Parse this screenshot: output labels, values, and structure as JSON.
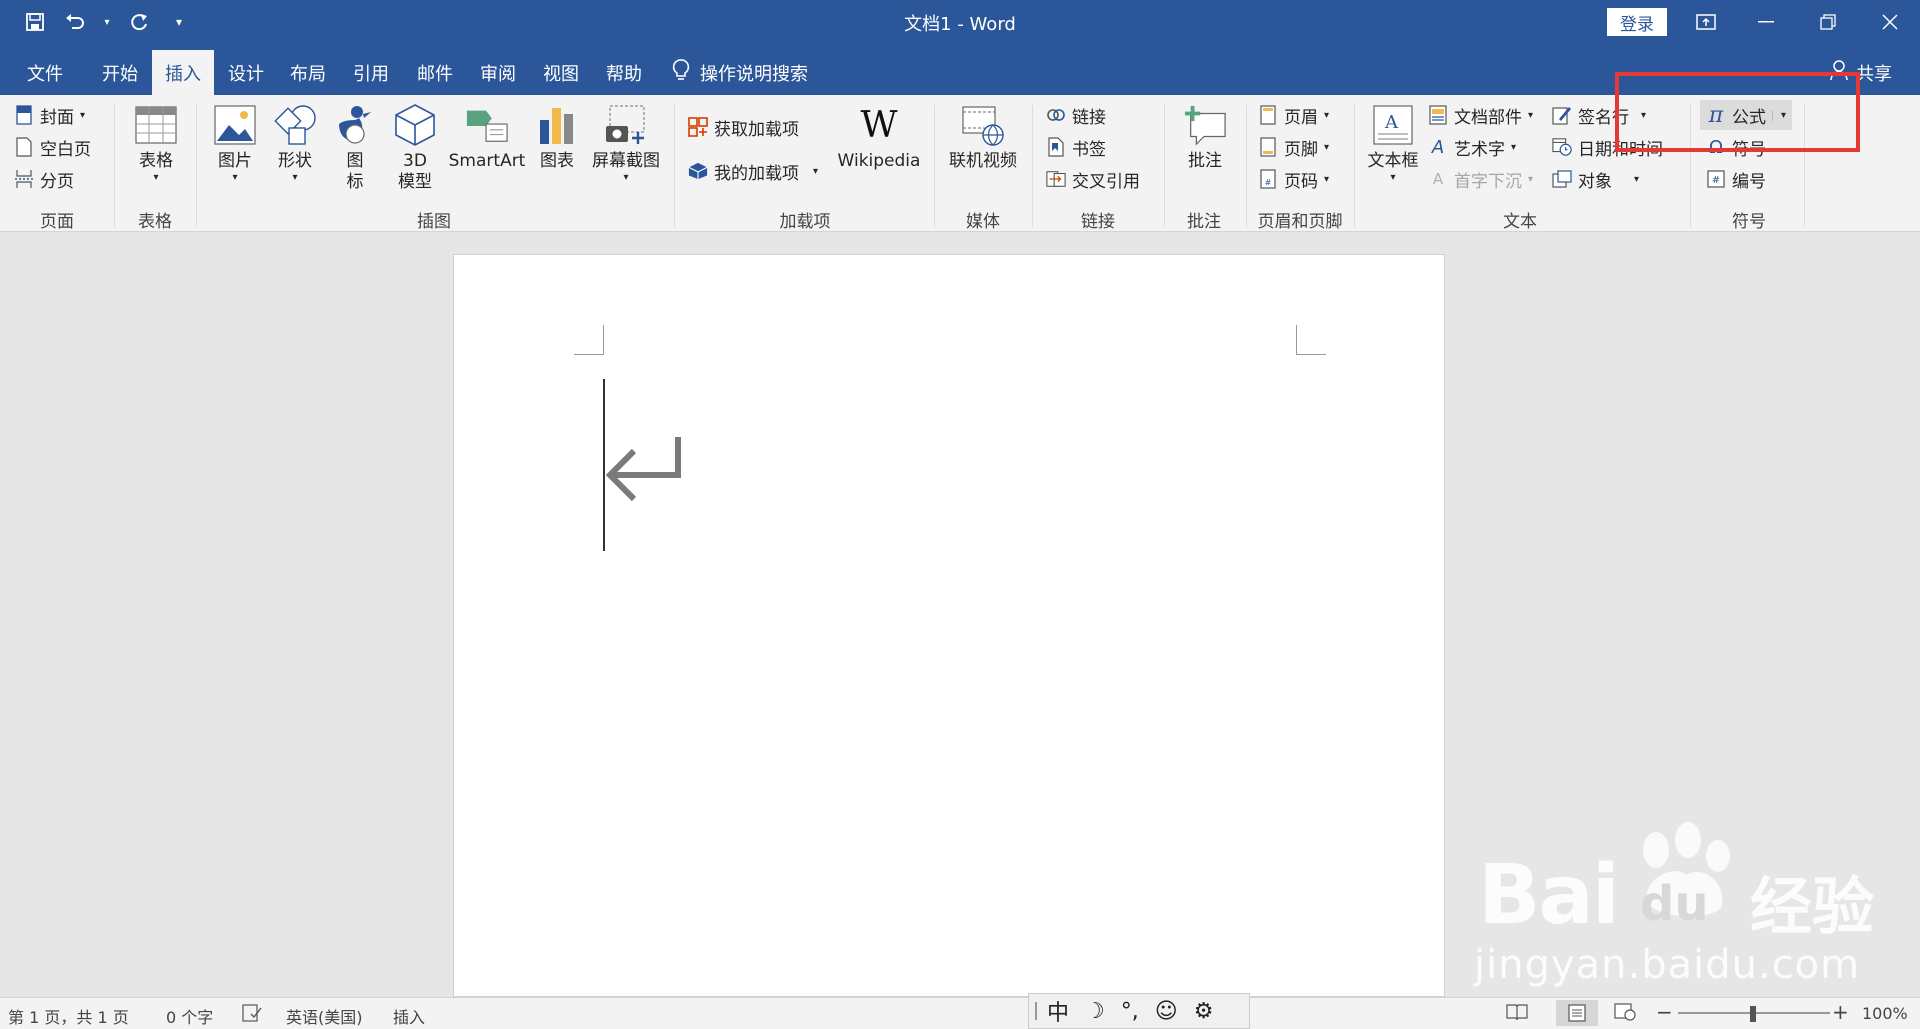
{
  "window": {
    "title": "文档1  -  Word",
    "login_label": "登录"
  },
  "qat": {
    "save_icon": "save-icon",
    "undo_icon": "undo-icon",
    "redo_icon": "redo-icon",
    "customize_icon": "customize-qat-icon"
  },
  "tabs": {
    "file": "文件",
    "home": "开始",
    "insert": "插入",
    "design": "设计",
    "layout": "布局",
    "references": "引用",
    "mailings": "邮件",
    "review": "审阅",
    "view": "视图",
    "help": "帮助",
    "tellme": "操作说明搜索",
    "share": "共享"
  },
  "ribbon": {
    "pages": {
      "label": "页面",
      "cover": "封面",
      "blank": "空白页",
      "break": "分页"
    },
    "tables": {
      "label": "表格",
      "table": "表格"
    },
    "illustrations": {
      "label": "插图",
      "pictures": "图片",
      "shapes": "形状",
      "icons_l1": "图",
      "icons_l2": "标",
      "model_l1": "3D",
      "model_l2": "模型",
      "smartart": "SmartArt",
      "chart": "图表",
      "screenshot": "屏幕截图"
    },
    "addins": {
      "label": "加载项",
      "get": "获取加载项",
      "my": "我的加载项",
      "wiki_logo": "W",
      "wikipedia": "Wikipedia"
    },
    "media": {
      "label": "媒体",
      "video": "联机视频"
    },
    "links": {
      "label": "链接",
      "link": "链接",
      "bookmark": "书签",
      "crossref": "交叉引用"
    },
    "comments": {
      "label": "批注",
      "comment": "批注"
    },
    "headerfooter": {
      "label": "页眉和页脚",
      "header": "页眉",
      "footer": "页脚",
      "pagenum": "页码"
    },
    "text": {
      "label": "文本",
      "textbox": "文本框",
      "quickparts": "文档部件",
      "wordart": "艺术字",
      "dropcap": "首字下沉",
      "signature": "签名行",
      "datetime": "日期和时间",
      "object": "对象"
    },
    "symbols": {
      "label": "符号",
      "equation_symbol": "π",
      "equation": "公式",
      "symbol": "符号",
      "number": "编号"
    }
  },
  "status": {
    "page": "第 1 页，共 1 页",
    "words": "0 个字",
    "language": "英语(美国)",
    "mode": "插入",
    "zoom": "100%"
  },
  "ime": {
    "lang": "中",
    "moon": "☽",
    "punct": "°,",
    "emoji": "☺",
    "settings": "⚙"
  },
  "watermark": {
    "brand": "Bai",
    "du": "du",
    "jingyan": "经验",
    "url": "jingyan.baidu.com"
  }
}
